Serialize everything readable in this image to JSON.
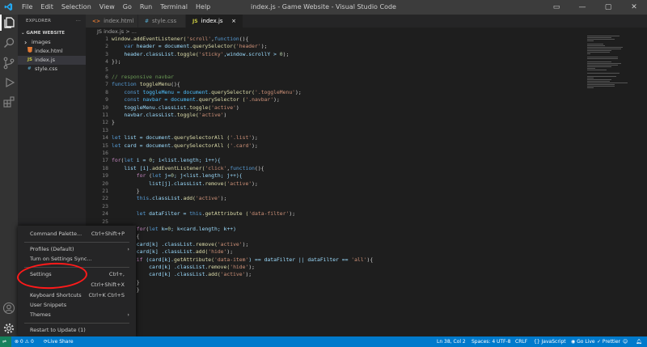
{
  "titlebar": {
    "menu": [
      "File",
      "Edit",
      "Selection",
      "View",
      "Go",
      "Run",
      "Terminal",
      "Help"
    ],
    "title": "index.js - Game Website - Visual Studio Code",
    "controls": [
      "▭",
      "—",
      "▢",
      "✕"
    ]
  },
  "explorer": {
    "header": "EXPLORER",
    "more": "···",
    "folder": "GAME WEBSITE",
    "items": [
      {
        "label": "images",
        "type": "folder",
        "icon": "chevron-right-icon"
      },
      {
        "label": "index.html",
        "type": "html",
        "icon": "html-file-icon",
        "color": "#e37933"
      },
      {
        "label": "index.js",
        "type": "js",
        "icon": "js-file-icon",
        "color": "#cbcb41",
        "glyph": "JS"
      },
      {
        "label": "style.css",
        "type": "css",
        "icon": "css-file-icon",
        "color": "#519aba",
        "glyph": "#"
      }
    ]
  },
  "tabs": [
    {
      "label": "index.html",
      "glyph": "<>",
      "color": "#e37933"
    },
    {
      "label": "style.css",
      "glyph": "#",
      "color": "#519aba"
    },
    {
      "label": "index.js",
      "glyph": "JS",
      "color": "#cbcb41",
      "close": "×"
    }
  ],
  "breadcrumb": "JS  index.js > ...",
  "code": [
    [
      [
        "window.addEventListener(",
        "#dcdcaa"
      ],
      [
        "'scroll'",
        "#ce9178"
      ],
      [
        ",",
        "#d4d4d4"
      ],
      [
        "function",
        "#569cd6"
      ],
      [
        "(){",
        "#d4d4d4"
      ]
    ],
    [
      [
        "    var ",
        "#569cd6"
      ],
      [
        "header = document.",
        "#9cdcfe"
      ],
      [
        "querySelector(",
        "#dcdcaa"
      ],
      [
        "'header'",
        "#ce9178"
      ],
      [
        ");",
        "#d4d4d4"
      ]
    ],
    [
      [
        "    header.classList.",
        "#9cdcfe"
      ],
      [
        "toggle(",
        "#dcdcaa"
      ],
      [
        "'sticky'",
        "#ce9178"
      ],
      [
        ",window.scrollY > ",
        "#9cdcfe"
      ],
      [
        "0",
        "#b5cea8"
      ],
      [
        ");",
        "#d4d4d4"
      ]
    ],
    [
      [
        "});",
        "#d4d4d4"
      ]
    ],
    [
      [
        "",
        "#d4d4d4"
      ]
    ],
    [
      [
        "// responsive navbar",
        "#6a9955"
      ]
    ],
    [
      [
        "function ",
        "#569cd6"
      ],
      [
        "toggleMenu",
        "#dcdcaa"
      ],
      [
        "(){",
        "#d4d4d4"
      ]
    ],
    [
      [
        "    const ",
        "#569cd6"
      ],
      [
        "toggleMenu = document.",
        "#4fc1ff"
      ],
      [
        "querySelector(",
        "#dcdcaa"
      ],
      [
        "'.toggleMenu'",
        "#ce9178"
      ],
      [
        ");",
        "#d4d4d4"
      ]
    ],
    [
      [
        "    const ",
        "#569cd6"
      ],
      [
        "navbar = document.",
        "#4fc1ff"
      ],
      [
        "querySelector (",
        "#dcdcaa"
      ],
      [
        "'.navbar'",
        "#ce9178"
      ],
      [
        ");",
        "#d4d4d4"
      ]
    ],
    [
      [
        "    toggleMenu.classList.",
        "#9cdcfe"
      ],
      [
        "toggle(",
        "#dcdcaa"
      ],
      [
        "'active'",
        "#ce9178"
      ],
      [
        ")",
        "#d4d4d4"
      ]
    ],
    [
      [
        "    navbar.classList.",
        "#9cdcfe"
      ],
      [
        "toggle(",
        "#dcdcaa"
      ],
      [
        "'active'",
        "#ce9178"
      ],
      [
        ")",
        "#d4d4d4"
      ]
    ],
    [
      [
        "}",
        "#d4d4d4"
      ]
    ],
    [
      [
        "",
        "#d4d4d4"
      ]
    ],
    [
      [
        "let ",
        "#569cd6"
      ],
      [
        "list = document.",
        "#9cdcfe"
      ],
      [
        "querySelectorAll (",
        "#dcdcaa"
      ],
      [
        "'.list'",
        "#ce9178"
      ],
      [
        ");",
        "#d4d4d4"
      ]
    ],
    [
      [
        "let ",
        "#569cd6"
      ],
      [
        "card = document.",
        "#9cdcfe"
      ],
      [
        "querySelectorAll (",
        "#dcdcaa"
      ],
      [
        "'.card'",
        "#ce9178"
      ],
      [
        ");",
        "#d4d4d4"
      ]
    ],
    [
      [
        "",
        "#d4d4d4"
      ]
    ],
    [
      [
        "for",
        "#c586c0"
      ],
      [
        "(",
        "#d4d4d4"
      ],
      [
        "let ",
        "#569cd6"
      ],
      [
        "i = ",
        "#9cdcfe"
      ],
      [
        "0",
        "#b5cea8"
      ],
      [
        "; i<list.length; i++){",
        "#9cdcfe"
      ]
    ],
    [
      [
        "    list [i].",
        "#9cdcfe"
      ],
      [
        "addEventListener(",
        "#dcdcaa"
      ],
      [
        "'click'",
        "#ce9178"
      ],
      [
        ",",
        "#d4d4d4"
      ],
      [
        "function",
        "#569cd6"
      ],
      [
        "(){",
        "#d4d4d4"
      ]
    ],
    [
      [
        "        for ",
        "#c586c0"
      ],
      [
        "(",
        "#d4d4d4"
      ],
      [
        "let ",
        "#569cd6"
      ],
      [
        "j=",
        "#9cdcfe"
      ],
      [
        "0",
        "#b5cea8"
      ],
      [
        "; j<list.length; j++){",
        "#9cdcfe"
      ]
    ],
    [
      [
        "            list[j].classList.",
        "#9cdcfe"
      ],
      [
        "remove(",
        "#dcdcaa"
      ],
      [
        "'active'",
        "#ce9178"
      ],
      [
        ");",
        "#d4d4d4"
      ]
    ],
    [
      [
        "        }",
        "#d4d4d4"
      ]
    ],
    [
      [
        "        this",
        "#569cd6"
      ],
      [
        ".classList.",
        "#9cdcfe"
      ],
      [
        "add(",
        "#dcdcaa"
      ],
      [
        "'active'",
        "#ce9178"
      ],
      [
        ");",
        "#d4d4d4"
      ]
    ],
    [
      [
        "",
        "#d4d4d4"
      ]
    ],
    [
      [
        "        let ",
        "#569cd6"
      ],
      [
        "dataFilter = ",
        "#9cdcfe"
      ],
      [
        "this",
        "#569cd6"
      ],
      [
        ".",
        "#d4d4d4"
      ],
      [
        "getAttribute (",
        "#dcdcaa"
      ],
      [
        "'data-filter'",
        "#ce9178"
      ],
      [
        ");",
        "#d4d4d4"
      ]
    ],
    [
      [
        "",
        "#d4d4d4"
      ]
    ],
    [
      [
        "        for",
        "#c586c0"
      ],
      [
        "(",
        "#d4d4d4"
      ],
      [
        "let ",
        "#569cd6"
      ],
      [
        "k=",
        "#9cdcfe"
      ],
      [
        "0",
        "#b5cea8"
      ],
      [
        "; k<card.length; k++)",
        "#9cdcfe"
      ]
    ],
    [
      [
        "        {",
        "#d4d4d4"
      ]
    ],
    [
      [
        "        card[k] .classList.",
        "#9cdcfe"
      ],
      [
        "remove(",
        "#dcdcaa"
      ],
      [
        "'active'",
        "#ce9178"
      ],
      [
        ");",
        "#d4d4d4"
      ]
    ],
    [
      [
        "        card[k] .classList.",
        "#9cdcfe"
      ],
      [
        "add(",
        "#dcdcaa"
      ],
      [
        "'hide'",
        "#ce9178"
      ],
      [
        ");",
        "#d4d4d4"
      ]
    ],
    [
      [
        "        if ",
        "#c586c0"
      ],
      [
        "(card[k].",
        "#9cdcfe"
      ],
      [
        "getAttribute(",
        "#dcdcaa"
      ],
      [
        "'data-item'",
        "#ce9178"
      ],
      [
        ") == dataFilter || dataFilter == ",
        "#9cdcfe"
      ],
      [
        "'all'",
        "#ce9178"
      ],
      [
        "){",
        "#d4d4d4"
      ]
    ],
    [
      [
        "            card[k] .classList.",
        "#9cdcfe"
      ],
      [
        "remove(",
        "#dcdcaa"
      ],
      [
        "'hide'",
        "#ce9178"
      ],
      [
        ");",
        "#d4d4d4"
      ]
    ],
    [
      [
        "            card[k] .classList.",
        "#9cdcfe"
      ],
      [
        "add(",
        "#dcdcaa"
      ],
      [
        "'active'",
        "#ce9178"
      ],
      [
        ");",
        "#d4d4d4"
      ]
    ],
    [
      [
        "        }",
        "#d4d4d4"
      ]
    ],
    [
      [
        "        }",
        "#d4d4d4"
      ]
    ]
  ],
  "context_menu": {
    "command_palette": {
      "label": "Command Palette...",
      "shortcut": "Ctrl+Shift+P"
    },
    "profiles": {
      "label": "Profiles (Default)",
      "arrow": "›"
    },
    "settings_sync": {
      "label": "Turn on Settings Sync..."
    },
    "settings": {
      "label": "Settings",
      "shortcut": "Ctrl+,"
    },
    "extensions": {
      "shortcut": "Ctrl+Shift+X"
    },
    "keyboard_shortcuts": {
      "label": "Keyboard Shortcuts",
      "shortcut": "Ctrl+K Ctrl+S"
    },
    "user_snippets": {
      "label": "User Snippets"
    },
    "themes": {
      "label": "Themes",
      "arrow": "›"
    },
    "restart": {
      "label": "Restart to Update (1)"
    }
  },
  "statusbar": {
    "problems": "⊗ 0 ⚠ 0",
    "live_share": "Live Share",
    "position": "Ln 38, Col 2",
    "spaces": "Spaces: 4",
    "encoding": "UTF-8",
    "eol": "CRLF",
    "language": "{} JavaScript",
    "go_live": "◉ Go Live",
    "prettier": "✓ Prettier",
    "accent": "#007acc"
  }
}
